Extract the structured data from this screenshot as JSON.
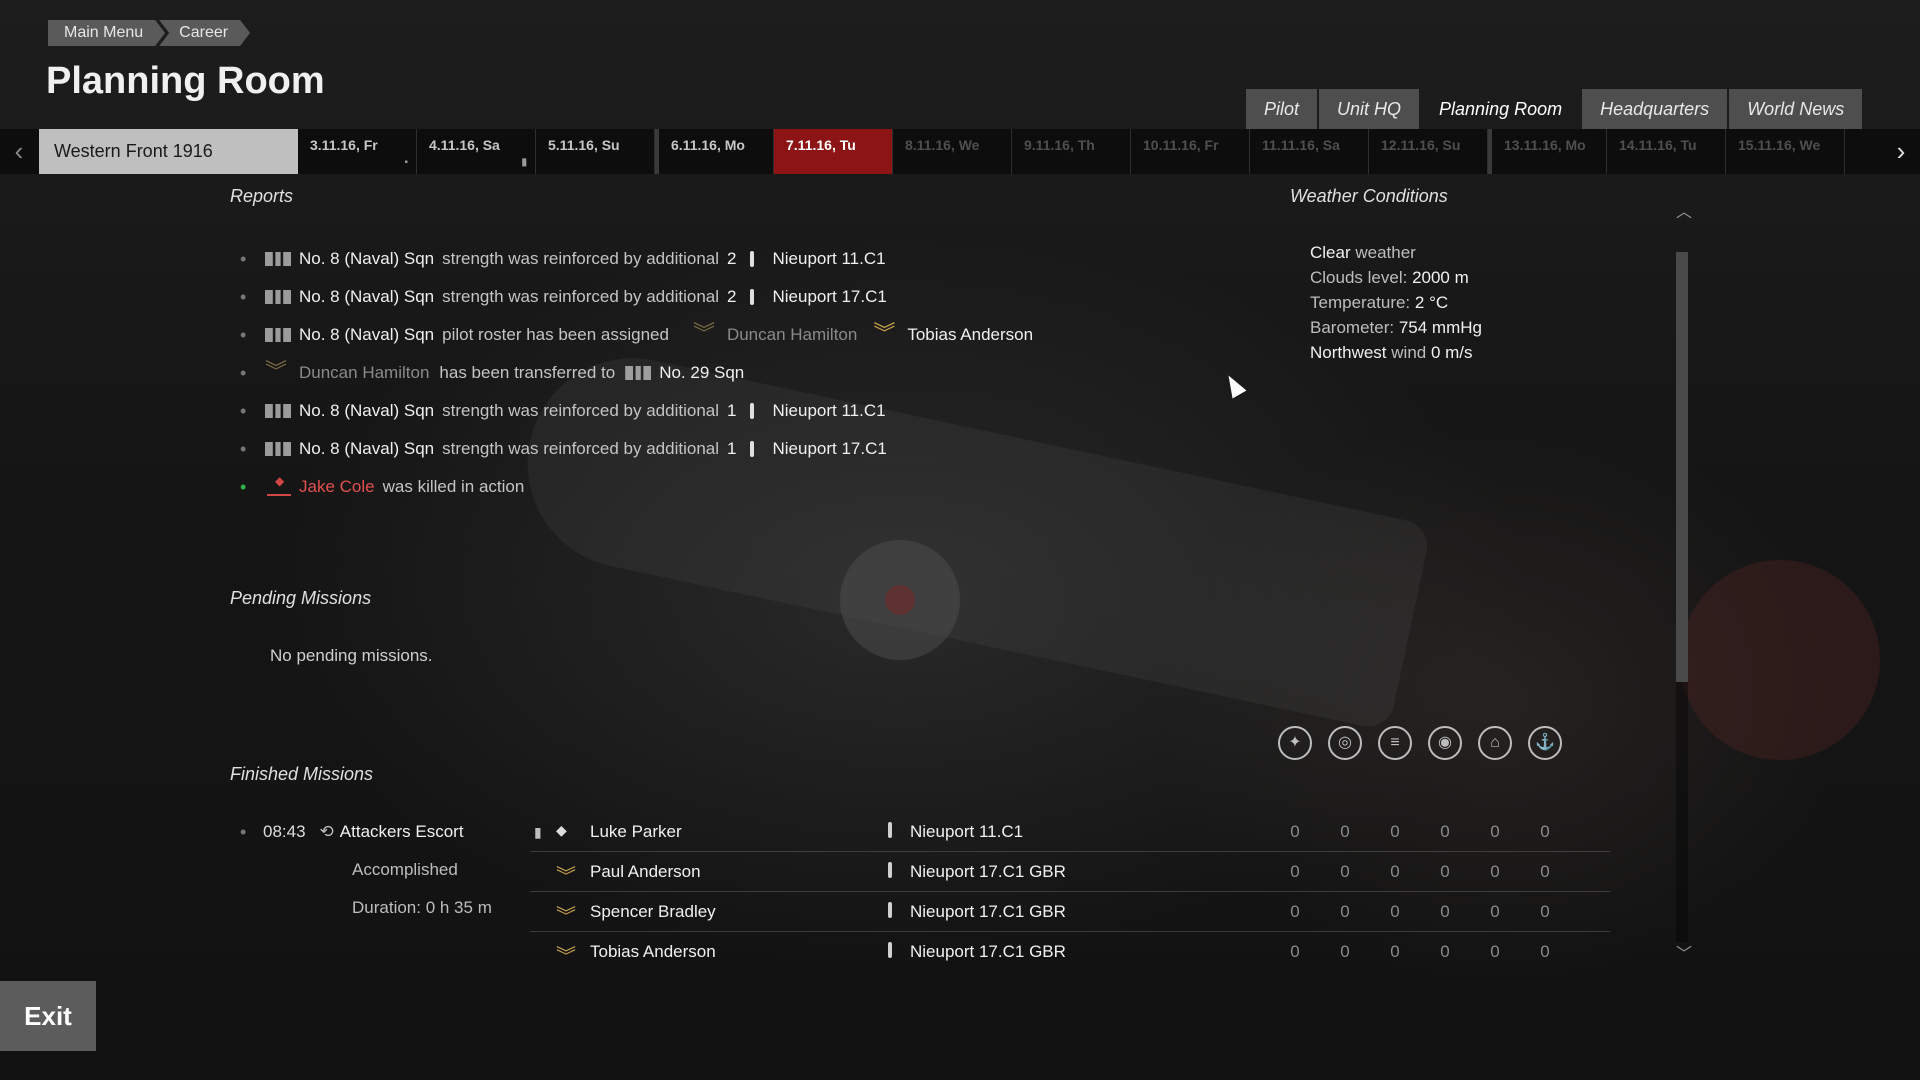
{
  "breadcrumbs": [
    "Main Menu",
    "Career"
  ],
  "page_title": "Planning Room",
  "tabs": [
    {
      "label": "Pilot"
    },
    {
      "label": "Unit HQ"
    },
    {
      "label": "Planning Room",
      "active": true
    },
    {
      "label": "Headquarters"
    },
    {
      "label": "World News"
    }
  ],
  "campaign": "Western Front 1916",
  "days": [
    {
      "label": "3.11.16, Fr",
      "state": "past"
    },
    {
      "label": "4.11.16, Sa",
      "state": "past"
    },
    {
      "label": "5.11.16, Su",
      "state": "past"
    },
    {
      "label": "6.11.16, Mo",
      "state": "past"
    },
    {
      "label": "7.11.16, Tu",
      "state": "today"
    },
    {
      "label": "8.11.16, We",
      "state": "future"
    },
    {
      "label": "9.11.16, Th",
      "state": "future"
    },
    {
      "label": "10.11.16, Fr",
      "state": "future"
    },
    {
      "label": "11.11.16, Sa",
      "state": "future"
    },
    {
      "label": "12.11.16, Su",
      "state": "future"
    },
    {
      "label": "13.11.16, Mo",
      "state": "future"
    },
    {
      "label": "14.11.16, Tu",
      "state": "future"
    },
    {
      "label": "15.11.16, We",
      "state": "future"
    }
  ],
  "reports_heading": "Reports",
  "reports": {
    "r1": {
      "unit": "No. 8 (Naval) Sqn",
      "text": "strength was reinforced by additional",
      "count": "2",
      "plane": "Nieuport 11.C1"
    },
    "r2": {
      "unit": "No. 8 (Naval) Sqn",
      "text": "strength was reinforced by additional",
      "count": "2",
      "plane": "Nieuport 17.C1"
    },
    "r3": {
      "unit": "No. 8 (Naval) Sqn",
      "text": "pilot roster has been assigned",
      "pilot1": "Duncan Hamilton",
      "pilot2": "Tobias Anderson"
    },
    "r4": {
      "pilot": "Duncan Hamilton",
      "text": "has been transferred to",
      "unit": "No. 29 Sqn"
    },
    "r5": {
      "unit": "No. 8 (Naval) Sqn",
      "text": "strength was reinforced by additional",
      "count": "1",
      "plane": "Nieuport 11.C1"
    },
    "r6": {
      "unit": "No. 8 (Naval) Sqn",
      "text": "strength was reinforced by additional",
      "count": "1",
      "plane": "Nieuport 17.C1"
    },
    "r7": {
      "pilot": "Jake Cole",
      "text": "was killed in action"
    }
  },
  "weather_heading": "Weather Conditions",
  "weather": {
    "clear_prefix": "Clear",
    "clear_suffix": "weather",
    "clouds_label": "Clouds level:",
    "clouds_value": "2000 m",
    "temp_label": "Temperature:",
    "temp_value": "2 °C",
    "baro_label": "Barometer:",
    "baro_value": "754 mmHg",
    "wind_dir": "Northwest",
    "wind_label": "wind",
    "wind_value": "0 m/s"
  },
  "pending_heading": "Pending Missions",
  "pending_empty": "No pending missions.",
  "finished_heading": "Finished Missions",
  "stat_icons": [
    "aircraft-kills-icon",
    "ground-kills-icon",
    "vehicle-kills-icon",
    "artillery-kills-icon",
    "ship-kills-icon",
    "naval-kills-icon"
  ],
  "mission": {
    "time": "08:43",
    "type": "Attackers Escort",
    "status": "Accomplished",
    "duration": "Duration: 0 h 35 m",
    "crew": [
      {
        "name": "Luke Parker",
        "plane": "Nieuport 11.C1",
        "stats": [
          "0",
          "0",
          "0",
          "0",
          "0",
          "0"
        ]
      },
      {
        "name": "Paul Anderson",
        "plane": "Nieuport 17.C1 GBR",
        "stats": [
          "0",
          "0",
          "0",
          "0",
          "0",
          "0"
        ]
      },
      {
        "name": "Spencer Bradley",
        "plane": "Nieuport 17.C1 GBR",
        "stats": [
          "0",
          "0",
          "0",
          "0",
          "0",
          "0"
        ]
      },
      {
        "name": "Tobias Anderson",
        "plane": "Nieuport 17.C1 GBR",
        "stats": [
          "0",
          "0",
          "0",
          "0",
          "0",
          "0"
        ]
      }
    ]
  },
  "exit_label": "Exit"
}
